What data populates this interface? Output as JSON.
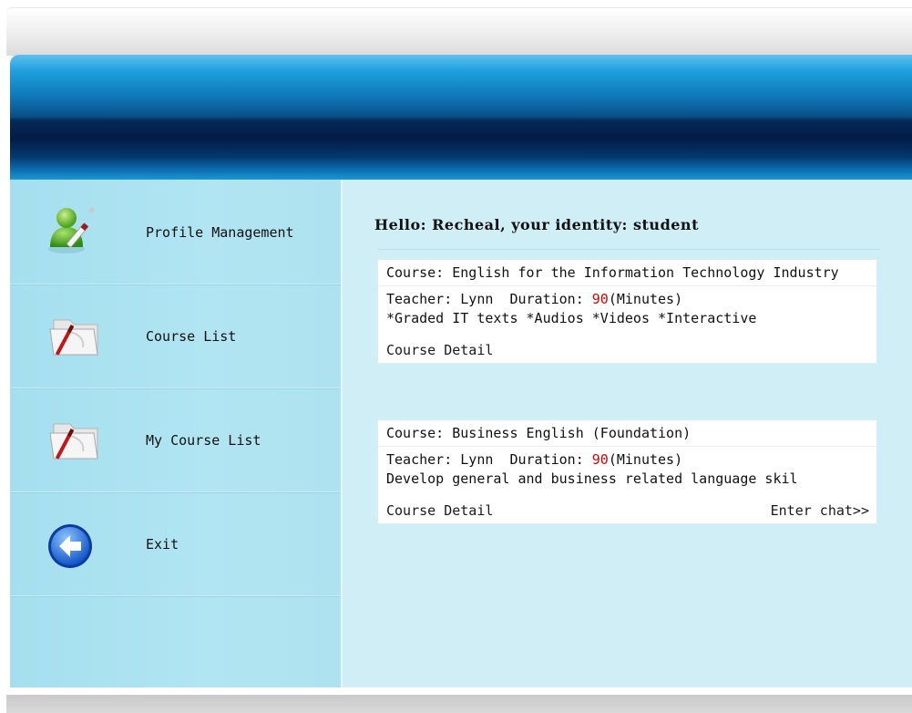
{
  "sidebar": {
    "items": [
      {
        "label": "Profile Management",
        "icon": "user-edit-icon"
      },
      {
        "label": "Course List",
        "icon": "folder-pen-icon"
      },
      {
        "label": "My Course List",
        "icon": "folder-pen-icon"
      },
      {
        "label": "Exit",
        "icon": "back-arrow-icon"
      }
    ]
  },
  "main": {
    "greeting": "Hello: Recheal, your identity: student",
    "courses": [
      {
        "title": "Course: English for the Information Technology Industry",
        "teacher_prefix": "Teacher: Lynn  Duration: ",
        "duration": "90",
        "duration_unit": "(Minutes)",
        "description": "*Graded IT texts *Audios *Videos *Interactive",
        "detail_link": "Course Detail"
      },
      {
        "title": "Course: Business English (Foundation)",
        "teacher_prefix": "Teacher: Lynn  Duration: ",
        "duration": "90",
        "duration_unit": "(Minutes)",
        "description": "Develop general and business related language skil",
        "detail_link": "Course Detail",
        "chat_link": "Enter chat>>"
      }
    ]
  },
  "colors": {
    "accent_number": "#e00000",
    "banner_dark": "#021c45",
    "sidebar_bg": "#a5dfef",
    "content_bg": "#cfeef6"
  }
}
